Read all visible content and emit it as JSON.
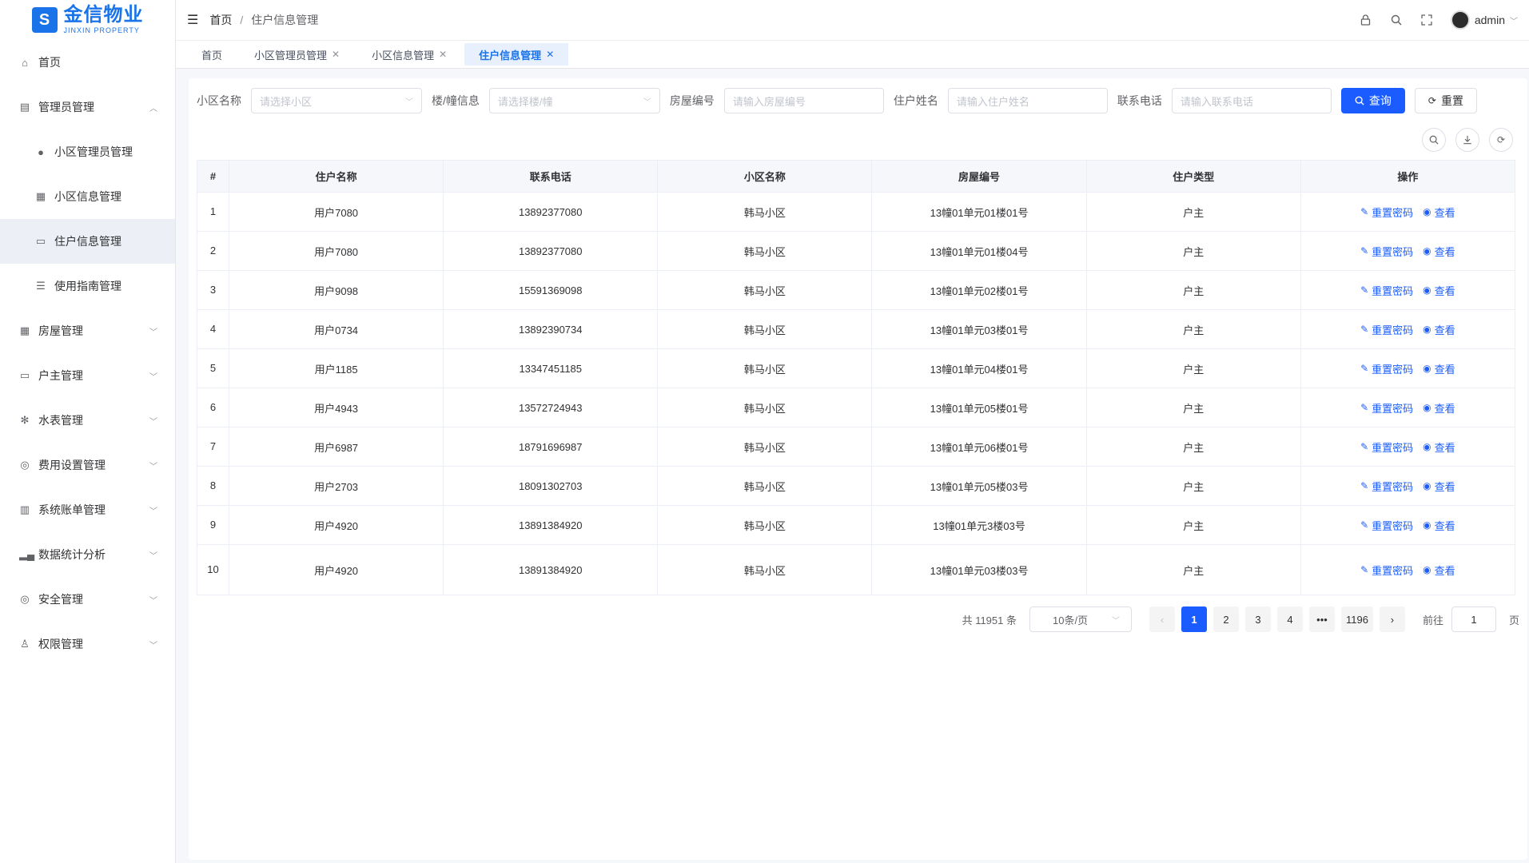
{
  "brand": {
    "name_cn": "金信物业",
    "name_en": "JINXIN PROPERTY",
    "mark": "S"
  },
  "sidebar": {
    "items": [
      {
        "label": "首页",
        "icon": "home-icon",
        "glyph": "⌂"
      },
      {
        "label": "管理员管理",
        "icon": "admin-icon",
        "glyph": "▤",
        "chevron": "︿"
      },
      {
        "label": "小区管理员管理",
        "icon": "user-icon",
        "glyph": "●",
        "sub": true
      },
      {
        "label": "小区信息管理",
        "icon": "building-icon",
        "glyph": "▦",
        "sub": true
      },
      {
        "label": "住户信息管理",
        "icon": "monitor-icon",
        "glyph": "▭",
        "sub": true,
        "active": true
      },
      {
        "label": "使用指南管理",
        "icon": "guide-icon",
        "glyph": "☰",
        "sub": true
      },
      {
        "label": "房屋管理",
        "icon": "grid-icon",
        "glyph": "▦",
        "chevron": "﹀"
      },
      {
        "label": "户主管理",
        "icon": "monitor-icon",
        "glyph": "▭",
        "chevron": "﹀"
      },
      {
        "label": "水表管理",
        "icon": "fan-icon",
        "glyph": "✻",
        "chevron": "﹀"
      },
      {
        "label": "费用设置管理",
        "icon": "settings-icon",
        "glyph": "◎",
        "chevron": "﹀"
      },
      {
        "label": "系统账单管理",
        "icon": "bill-icon",
        "glyph": "▥",
        "chevron": "﹀"
      },
      {
        "label": "数据统计分析",
        "icon": "chart-icon",
        "glyph": "▂▄",
        "chevron": "﹀"
      },
      {
        "label": "安全管理",
        "icon": "shield-icon",
        "glyph": "◎",
        "chevron": "﹀"
      },
      {
        "label": "权限管理",
        "icon": "person-icon",
        "glyph": "♙",
        "chevron": "﹀"
      }
    ]
  },
  "header": {
    "breadcrumb": [
      "首页",
      "住户信息管理"
    ],
    "user": "admin"
  },
  "tabs": [
    {
      "label": "首页",
      "closable": false
    },
    {
      "label": "小区管理员管理",
      "closable": true
    },
    {
      "label": "小区信息管理",
      "closable": true
    },
    {
      "label": "住户信息管理",
      "closable": true,
      "active": true
    }
  ],
  "filters": {
    "community": {
      "label": "小区名称",
      "placeholder": "请选择小区"
    },
    "building": {
      "label": "楼/幢信息",
      "placeholder": "请选择楼/幢"
    },
    "house": {
      "label": "房屋编号",
      "placeholder": "请输入房屋编号"
    },
    "resident": {
      "label": "住户姓名",
      "placeholder": "请输入住户姓名"
    },
    "phone": {
      "label": "联系电话",
      "placeholder": "请输入联系电话"
    },
    "search_label": "查询",
    "reset_label": "重置"
  },
  "table": {
    "columns": [
      "#",
      "住户名称",
      "联系电话",
      "小区名称",
      "房屋编号",
      "住户类型",
      "操作"
    ],
    "actions": {
      "reset": "重置密码",
      "view": "查看"
    },
    "rows": [
      [
        "1",
        "用户7080",
        "13892377080",
        "韩马小区",
        "13幢01单元01楼01号",
        "户主"
      ],
      [
        "2",
        "用户7080",
        "13892377080",
        "韩马小区",
        "13幢01单元01楼04号",
        "户主"
      ],
      [
        "3",
        "用户9098",
        "15591369098",
        "韩马小区",
        "13幢01单元02楼01号",
        "户主"
      ],
      [
        "4",
        "用户0734",
        "13892390734",
        "韩马小区",
        "13幢01单元03楼01号",
        "户主"
      ],
      [
        "5",
        "用户1185",
        "13347451185",
        "韩马小区",
        "13幢01单元04楼01号",
        "户主"
      ],
      [
        "6",
        "用户4943",
        "13572724943",
        "韩马小区",
        "13幢01单元05楼01号",
        "户主"
      ],
      [
        "7",
        "用户6987",
        "18791696987",
        "韩马小区",
        "13幢01单元06楼01号",
        "户主"
      ],
      [
        "8",
        "用户2703",
        "18091302703",
        "韩马小区",
        "13幢01单元05楼03号",
        "户主"
      ],
      [
        "9",
        "用户4920",
        "13891384920",
        "韩马小区",
        "13幢01单元3楼03号",
        "户主"
      ],
      [
        "10",
        "用户4920",
        "13891384920",
        "韩马小区",
        "13幢01单元03楼03号",
        "户主"
      ]
    ]
  },
  "pagination": {
    "total": "共 11951 条",
    "page_size": "10条/页",
    "pages": [
      "1",
      "2",
      "3",
      "4",
      "•••",
      "1196"
    ],
    "current": "1",
    "goto_label": "前往",
    "goto_value": "1",
    "page_suffix": "页"
  }
}
